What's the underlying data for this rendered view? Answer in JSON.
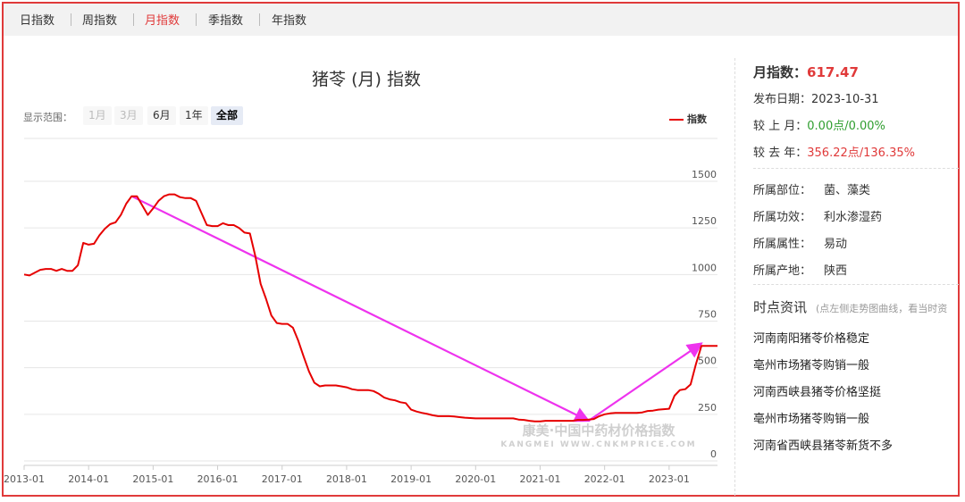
{
  "tabs": [
    {
      "label": "日指数",
      "active": false
    },
    {
      "label": "周指数",
      "active": false
    },
    {
      "label": "月指数",
      "active": true
    },
    {
      "label": "季指数",
      "active": false
    },
    {
      "label": "年指数",
      "active": false
    }
  ],
  "range": {
    "label": "显示范围：",
    "buttons": [
      {
        "label": "1月",
        "state": "disabled"
      },
      {
        "label": "3月",
        "state": "disabled"
      },
      {
        "label": "6月",
        "state": "normal"
      },
      {
        "label": "1年",
        "state": "normal"
      },
      {
        "label": "全部",
        "state": "selected"
      }
    ]
  },
  "watermark": {
    "line1": "康美·中国中药材价格指数",
    "line2": "KANGMEI WWW.CNKMPRICE.COM"
  },
  "chart_data": {
    "type": "line",
    "title": "猪苓 (月) 指数",
    "legend": "指数",
    "legend_position": "top-right",
    "grid": true,
    "color": "#e60000",
    "ylim": [
      0,
      1500
    ],
    "yticks": [
      "1500",
      "1250",
      "1000",
      "750",
      "500",
      "250",
      "0"
    ],
    "ytick_values": [
      1500,
      1250,
      1000,
      750,
      500,
      250,
      0
    ],
    "xlim": [
      "2013-01",
      "2023-10"
    ],
    "xticks": [
      "2013-01",
      "2014-01",
      "2015-01",
      "2016-01",
      "2017-01",
      "2018-01",
      "2019-01",
      "2020-01",
      "2021-01",
      "2022-01",
      "2023-01"
    ],
    "series": [
      {
        "points": [
          [
            "2013-01",
            1000
          ],
          [
            "2013-02",
            995
          ],
          [
            "2013-03",
            1010
          ],
          [
            "2013-04",
            1025
          ],
          [
            "2013-05",
            1030
          ],
          [
            "2013-06",
            1030
          ],
          [
            "2013-07",
            1020
          ],
          [
            "2013-08",
            1030
          ],
          [
            "2013-09",
            1020
          ],
          [
            "2013-10",
            1020
          ],
          [
            "2013-11",
            1050
          ],
          [
            "2013-12",
            1170
          ],
          [
            "2014-01",
            1160
          ],
          [
            "2014-02",
            1165
          ],
          [
            "2014-03",
            1210
          ],
          [
            "2014-04",
            1245
          ],
          [
            "2014-05",
            1270
          ],
          [
            "2014-06",
            1280
          ],
          [
            "2014-07",
            1320
          ],
          [
            "2014-08",
            1380
          ],
          [
            "2014-09",
            1420
          ],
          [
            "2014-10",
            1420
          ],
          [
            "2014-11",
            1370
          ],
          [
            "2014-12",
            1320
          ],
          [
            "2015-01",
            1355
          ],
          [
            "2015-02",
            1395
          ],
          [
            "2015-03",
            1420
          ],
          [
            "2015-04",
            1430
          ],
          [
            "2015-05",
            1430
          ],
          [
            "2015-06",
            1415
          ],
          [
            "2015-07",
            1410
          ],
          [
            "2015-08",
            1410
          ],
          [
            "2015-09",
            1395
          ],
          [
            "2015-10",
            1330
          ],
          [
            "2015-11",
            1265
          ],
          [
            "2015-12",
            1260
          ],
          [
            "2016-01",
            1260
          ],
          [
            "2016-02",
            1275
          ],
          [
            "2016-03",
            1265
          ],
          [
            "2016-04",
            1265
          ],
          [
            "2016-05",
            1250
          ],
          [
            "2016-06",
            1225
          ],
          [
            "2016-07",
            1220
          ],
          [
            "2016-08",
            1100
          ],
          [
            "2016-09",
            950
          ],
          [
            "2016-10",
            870
          ],
          [
            "2016-11",
            780
          ],
          [
            "2016-12",
            740
          ],
          [
            "2017-01",
            735
          ],
          [
            "2017-02",
            735
          ],
          [
            "2017-03",
            715
          ],
          [
            "2017-04",
            645
          ],
          [
            "2017-05",
            560
          ],
          [
            "2017-06",
            480
          ],
          [
            "2017-07",
            420
          ],
          [
            "2017-08",
            400
          ],
          [
            "2017-09",
            405
          ],
          [
            "2017-10",
            405
          ],
          [
            "2017-11",
            405
          ],
          [
            "2017-12",
            400
          ],
          [
            "2018-01",
            395
          ],
          [
            "2018-02",
            385
          ],
          [
            "2018-03",
            380
          ],
          [
            "2018-04",
            380
          ],
          [
            "2018-05",
            380
          ],
          [
            "2018-06",
            375
          ],
          [
            "2018-07",
            360
          ],
          [
            "2018-08",
            340
          ],
          [
            "2018-09",
            330
          ],
          [
            "2018-10",
            325
          ],
          [
            "2018-11",
            315
          ],
          [
            "2018-12",
            310
          ],
          [
            "2019-01",
            275
          ],
          [
            "2019-02",
            265
          ],
          [
            "2019-03",
            258
          ],
          [
            "2019-04",
            252
          ],
          [
            "2019-05",
            245
          ],
          [
            "2019-06",
            240
          ],
          [
            "2019-07",
            240
          ],
          [
            "2019-08",
            240
          ],
          [
            "2019-09",
            238
          ],
          [
            "2019-10",
            235
          ],
          [
            "2019-11",
            232
          ],
          [
            "2019-12",
            230
          ],
          [
            "2020-01",
            228
          ],
          [
            "2020-02",
            228
          ],
          [
            "2020-03",
            228
          ],
          [
            "2020-04",
            228
          ],
          [
            "2020-05",
            228
          ],
          [
            "2020-06",
            228
          ],
          [
            "2020-07",
            228
          ],
          [
            "2020-08",
            228
          ],
          [
            "2020-09",
            222
          ],
          [
            "2020-10",
            220
          ],
          [
            "2020-11",
            215
          ],
          [
            "2020-12",
            212
          ],
          [
            "2021-01",
            212
          ],
          [
            "2021-02",
            215
          ],
          [
            "2021-03",
            215
          ],
          [
            "2021-04",
            215
          ],
          [
            "2021-05",
            215
          ],
          [
            "2021-06",
            215
          ],
          [
            "2021-07",
            215
          ],
          [
            "2021-08",
            220
          ],
          [
            "2021-09",
            220
          ],
          [
            "2021-10",
            222
          ],
          [
            "2021-11",
            225
          ],
          [
            "2021-12",
            240
          ],
          [
            "2022-01",
            250
          ],
          [
            "2022-02",
            255
          ],
          [
            "2022-03",
            258
          ],
          [
            "2022-04",
            258
          ],
          [
            "2022-05",
            258
          ],
          [
            "2022-06",
            258
          ],
          [
            "2022-07",
            258
          ],
          [
            "2022-08",
            260
          ],
          [
            "2022-09",
            268
          ],
          [
            "2022-10",
            270
          ],
          [
            "2022-11",
            275
          ],
          [
            "2023-01",
            280
          ],
          [
            "2023-02",
            350
          ],
          [
            "2023-03",
            380
          ],
          [
            "2023-04",
            385
          ],
          [
            "2023-05",
            410
          ],
          [
            "2023-06",
            520
          ],
          [
            "2023-07",
            617
          ],
          [
            "2023-08",
            617
          ],
          [
            "2023-09",
            617
          ],
          [
            "2023-10",
            617
          ]
        ]
      }
    ],
    "annotations": [
      {
        "type": "arrow",
        "color": "#ee33ee",
        "from": [
          "2014-09",
          1420
        ],
        "to": [
          "2021-10",
          215
        ]
      },
      {
        "type": "arrow",
        "color": "#ee33ee",
        "from": [
          "2021-10",
          215
        ],
        "to": [
          "2023-07",
          630
        ]
      }
    ]
  },
  "panel": {
    "index_label": "月指数：",
    "index_value": "617.47",
    "date_label": "发布日期：",
    "date_value": "2023-10-31",
    "mom_label": "较 上 月：",
    "mom_value": "0.00点/0.00%",
    "yoy_label": "较 去 年：",
    "yoy_value": "356.22点/136.35%",
    "attrs": [
      {
        "label": "所属部位：",
        "value": "菌、藻类"
      },
      {
        "label": "所属功效：",
        "value": "利水渗湿药"
      },
      {
        "label": "所属属性：",
        "value": "易动"
      },
      {
        "label": "所属产地：",
        "value": "陕西"
      }
    ],
    "news_title": "时点资讯",
    "news_hint": "(点左侧走势图曲线，看当时资",
    "news": [
      "河南南阳猪苓价格稳定",
      "亳州市场猪苓购销一般",
      "河南西峡县猪苓价格坚挺",
      "亳州市场猪苓购销一般",
      "河南省西峡县猪苓新货不多"
    ]
  }
}
